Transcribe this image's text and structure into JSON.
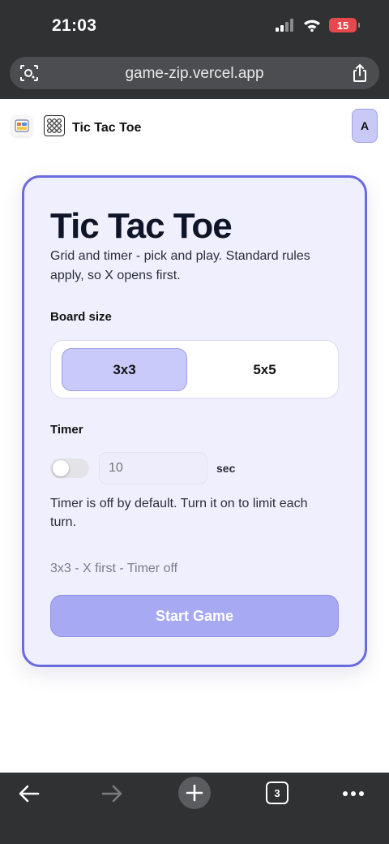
{
  "status_bar": {
    "time": "21:03",
    "battery": "15",
    "icons": [
      "signal-icon",
      "wifi-icon",
      "battery-icon"
    ]
  },
  "browser": {
    "url": "game-zip.vercel.app",
    "tabs_count": "3"
  },
  "header": {
    "title": "Tic Tac Toe",
    "avatar_initial": "A"
  },
  "game": {
    "title": "Tic Tac Toe",
    "description": "Grid and timer - pick and play. Standard rules apply, so X opens first.",
    "board_size_label": "Board size",
    "board_sizes": [
      "3x3",
      "5x5"
    ],
    "selected_board_size": "3x3",
    "timer_label": "Timer",
    "timer_enabled": false,
    "timer_placeholder": "10",
    "timer_unit": "sec",
    "timer_help": "Timer is off by default. Turn it on to limit each turn.",
    "summary": "3x3 - X first - Timer off",
    "start_label": "Start Game"
  },
  "colors": {
    "accent": "#6a6bdc",
    "card_bg": "#efeffd",
    "selected_option": "#c9cafa",
    "start_button": "#a7a9f3",
    "chrome": "#2f3133",
    "battery": "#e5484d"
  }
}
